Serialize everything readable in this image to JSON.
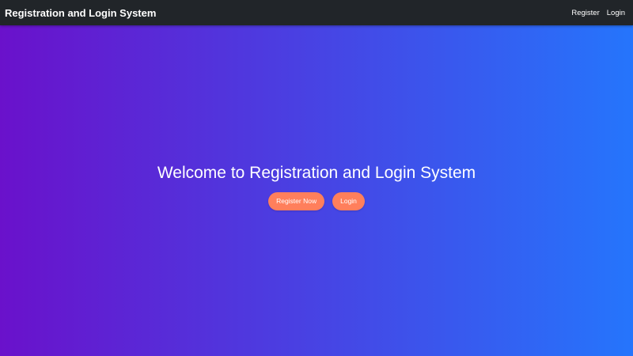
{
  "navbar": {
    "brand": "Registration and Login System",
    "links": [
      {
        "label": "Register"
      },
      {
        "label": "Login"
      }
    ]
  },
  "hero": {
    "title": "Welcome to Registration and Login System",
    "buttons": [
      {
        "label": "Register Now"
      },
      {
        "label": "Login"
      }
    ]
  },
  "colors": {
    "navbar_bg": "#212529",
    "gradient_start": "#6a11cb",
    "gradient_end": "#2575fc",
    "button_bg": "#ff7f5c"
  }
}
